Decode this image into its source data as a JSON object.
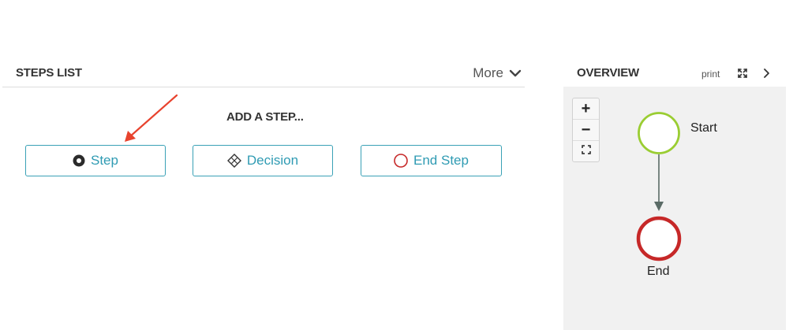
{
  "steps_list": {
    "title": "STEPS LIST",
    "more_label": "More",
    "add_step_heading": "ADD A STEP...",
    "buttons": [
      {
        "label": "Step",
        "icon": "filled-circle-icon"
      },
      {
        "label": "Decision",
        "icon": "diamond-icon"
      },
      {
        "label": "End Step",
        "icon": "red-circle-icon"
      }
    ]
  },
  "overview": {
    "title": "OVERVIEW",
    "print_label": "print",
    "zoom_in_glyph": "+",
    "zoom_out_glyph": "−",
    "nodes": [
      {
        "label": "Start",
        "color": "#9acd32"
      },
      {
        "label": "End",
        "color": "#c62828"
      }
    ]
  },
  "colors": {
    "accent": "#3aa1b6",
    "annotation_arrow": "#e8432e",
    "canvas_bg": "#f1f1f1"
  }
}
